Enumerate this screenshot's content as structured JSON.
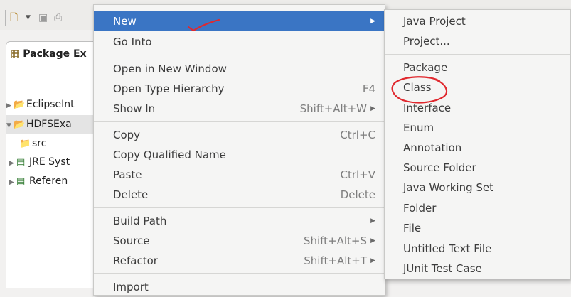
{
  "toolbar": {
    "icons": [
      "new-icon",
      "dropdown-arrow-icon",
      "save-icon",
      "print-icon"
    ]
  },
  "package_explorer": {
    "tab_label": "Package Ex",
    "tab_icon": "package-explorer-icon",
    "tree": [
      {
        "label": "EclipseInt",
        "icon": "project-icon",
        "expanded": false
      },
      {
        "label": "HDFSExa",
        "icon": "project-icon",
        "expanded": true,
        "selected": true
      },
      {
        "label": "src",
        "icon": "source-folder-icon"
      },
      {
        "label": "JRE Syst",
        "icon": "library-icon",
        "expanded": false
      },
      {
        "label": "Referen",
        "icon": "library-icon",
        "expanded": false
      }
    ]
  },
  "context_menu": {
    "items": [
      {
        "label": "New",
        "submenu": true,
        "highlighted": true
      },
      {
        "label": "Go Into"
      },
      {
        "label": "Open in New Window"
      },
      {
        "label": "Open Type Hierarchy",
        "shortcut": "F4"
      },
      {
        "label": "Show In",
        "shortcut": "Shift+Alt+W",
        "submenu": true
      },
      {
        "label": "Copy",
        "shortcut": "Ctrl+C"
      },
      {
        "label": "Copy Qualified Name"
      },
      {
        "label": "Paste",
        "shortcut": "Ctrl+V"
      },
      {
        "label": "Delete",
        "shortcut": "Delete"
      },
      {
        "label": "Build Path",
        "submenu": true
      },
      {
        "label": "Source",
        "shortcut": "Shift+Alt+S",
        "submenu": true
      },
      {
        "label": "Refactor",
        "shortcut": "Shift+Alt+T",
        "submenu": true
      },
      {
        "label": "Import"
      }
    ]
  },
  "new_submenu": {
    "items": [
      {
        "label": "Java Project"
      },
      {
        "label": "Project..."
      },
      {
        "label": "Package"
      },
      {
        "label": "Class",
        "annotated": true
      },
      {
        "label": "Interface"
      },
      {
        "label": "Enum"
      },
      {
        "label": "Annotation"
      },
      {
        "label": "Source Folder"
      },
      {
        "label": "Java Working Set"
      },
      {
        "label": "Folder"
      },
      {
        "label": "File"
      },
      {
        "label": "Untitled Text File"
      },
      {
        "label": "JUnit Test Case"
      }
    ]
  },
  "colors": {
    "highlight": "#3a75c4",
    "annotation": "#e0282e"
  }
}
